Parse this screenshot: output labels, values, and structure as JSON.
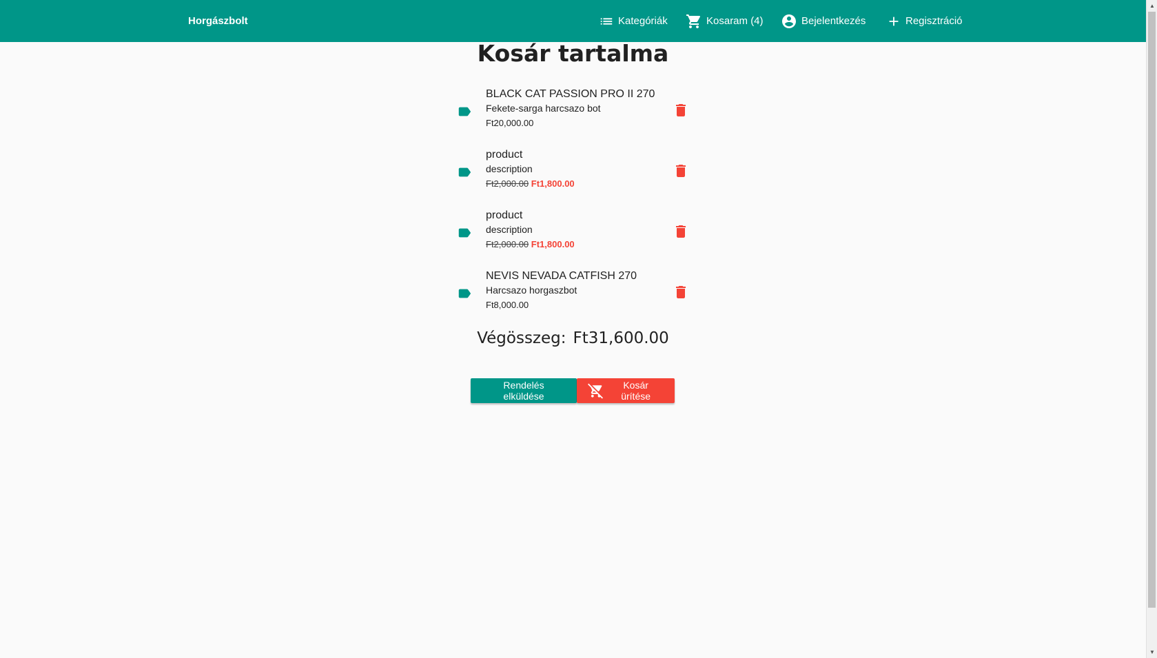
{
  "colors": {
    "primary": "#009688",
    "danger": "#f44336",
    "background": "#fafafa"
  },
  "header": {
    "brand": "Horgászbolt",
    "nav": {
      "categories": {
        "label": "Kategóriák",
        "icon": "list-icon"
      },
      "cart": {
        "label": "Kosaram (4)",
        "icon": "cart-icon"
      },
      "login": {
        "label": "Bejelentkezés",
        "icon": "account-circle-icon"
      },
      "register": {
        "label": "Regisztráció",
        "icon": "plus-icon"
      }
    }
  },
  "main": {
    "title": "Kosár tartalma",
    "items": [
      {
        "name": "BLACK CAT PASSION PRO II 270",
        "description": "Fekete-sarga harcsazo bot",
        "price": "Ft20,000.00",
        "old_price": null,
        "new_price": null
      },
      {
        "name": "product",
        "description": "description",
        "price": null,
        "old_price": "Ft2,000.00",
        "new_price": "Ft1,800.00"
      },
      {
        "name": "product",
        "description": "description",
        "price": null,
        "old_price": "Ft2,000.00",
        "new_price": "Ft1,800.00"
      },
      {
        "name": "NEVIS NEVADA CATFISH 270",
        "description": "Harcsazo horgaszbot",
        "price": "Ft8,000.00",
        "old_price": null,
        "new_price": null
      }
    ],
    "total_label": "Végösszeg:",
    "total_value": "Ft31,600.00",
    "buttons": {
      "submit_order": "Rendelés elküldése",
      "empty_cart": "Kosár ürítése"
    }
  }
}
